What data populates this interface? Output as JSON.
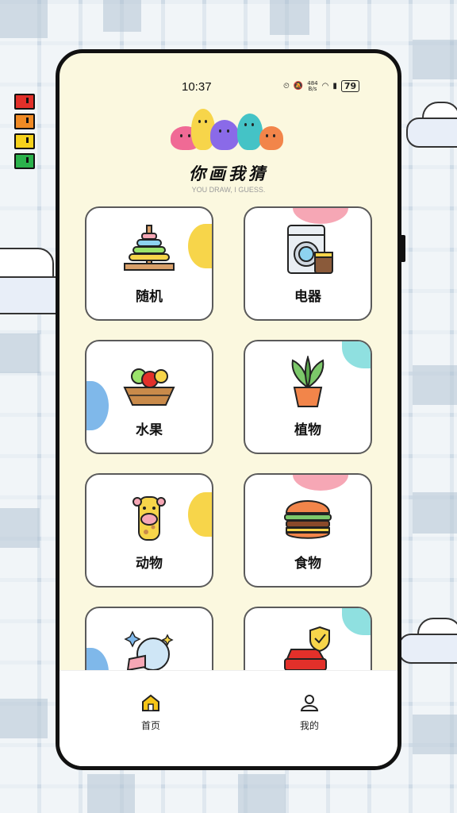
{
  "status_bar": {
    "time": "10:37",
    "net_speed_value": "484",
    "net_speed_unit": "B/s",
    "battery": "79"
  },
  "app": {
    "title": "你画我猜",
    "subtitle": "YOU DRAW, I GUESS."
  },
  "categories": [
    {
      "label": "随机",
      "icon": "ring-stacker-toy-icon",
      "deco_color": "#f7d54a"
    },
    {
      "label": "电器",
      "icon": "washing-machine-icon",
      "deco_color": "#f6a7b5"
    },
    {
      "label": "水果",
      "icon": "fruit-basket-icon",
      "deco_color": "#7fb8ea"
    },
    {
      "label": "植物",
      "icon": "potted-plant-icon",
      "deco_color": "#8fe0e0"
    },
    {
      "label": "动物",
      "icon": "giraffe-icon",
      "deco_color": "#f7d54a"
    },
    {
      "label": "食物",
      "icon": "hamburger-icon",
      "deco_color": "#f6a7b5"
    },
    {
      "label": "",
      "icon": "planet-icon",
      "deco_color": "#7fb8ea"
    },
    {
      "label": "",
      "icon": "car-insurance-icon",
      "deco_color": "#8fe0e0"
    }
  ],
  "tabbar": {
    "home_label": "首页",
    "mine_label": "我的",
    "accent": "#f5c518"
  }
}
